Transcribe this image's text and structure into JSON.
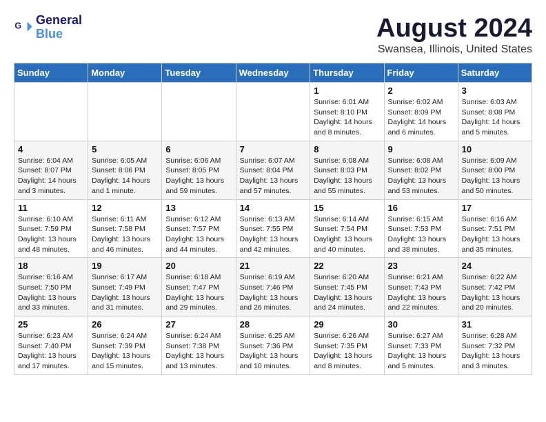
{
  "header": {
    "logo_line1": "General",
    "logo_line2": "Blue",
    "title": "August 2024",
    "subtitle": "Swansea, Illinois, United States"
  },
  "weekdays": [
    "Sunday",
    "Monday",
    "Tuesday",
    "Wednesday",
    "Thursday",
    "Friday",
    "Saturday"
  ],
  "weeks": [
    [
      {
        "day": "",
        "info": ""
      },
      {
        "day": "",
        "info": ""
      },
      {
        "day": "",
        "info": ""
      },
      {
        "day": "",
        "info": ""
      },
      {
        "day": "1",
        "info": "Sunrise: 6:01 AM\nSunset: 8:10 PM\nDaylight: 14 hours\nand 8 minutes."
      },
      {
        "day": "2",
        "info": "Sunrise: 6:02 AM\nSunset: 8:09 PM\nDaylight: 14 hours\nand 6 minutes."
      },
      {
        "day": "3",
        "info": "Sunrise: 6:03 AM\nSunset: 8:08 PM\nDaylight: 14 hours\nand 5 minutes."
      }
    ],
    [
      {
        "day": "4",
        "info": "Sunrise: 6:04 AM\nSunset: 8:07 PM\nDaylight: 14 hours\nand 3 minutes."
      },
      {
        "day": "5",
        "info": "Sunrise: 6:05 AM\nSunset: 8:06 PM\nDaylight: 14 hours\nand 1 minute."
      },
      {
        "day": "6",
        "info": "Sunrise: 6:06 AM\nSunset: 8:05 PM\nDaylight: 13 hours\nand 59 minutes."
      },
      {
        "day": "7",
        "info": "Sunrise: 6:07 AM\nSunset: 8:04 PM\nDaylight: 13 hours\nand 57 minutes."
      },
      {
        "day": "8",
        "info": "Sunrise: 6:08 AM\nSunset: 8:03 PM\nDaylight: 13 hours\nand 55 minutes."
      },
      {
        "day": "9",
        "info": "Sunrise: 6:08 AM\nSunset: 8:02 PM\nDaylight: 13 hours\nand 53 minutes."
      },
      {
        "day": "10",
        "info": "Sunrise: 6:09 AM\nSunset: 8:00 PM\nDaylight: 13 hours\nand 50 minutes."
      }
    ],
    [
      {
        "day": "11",
        "info": "Sunrise: 6:10 AM\nSunset: 7:59 PM\nDaylight: 13 hours\nand 48 minutes."
      },
      {
        "day": "12",
        "info": "Sunrise: 6:11 AM\nSunset: 7:58 PM\nDaylight: 13 hours\nand 46 minutes."
      },
      {
        "day": "13",
        "info": "Sunrise: 6:12 AM\nSunset: 7:57 PM\nDaylight: 13 hours\nand 44 minutes."
      },
      {
        "day": "14",
        "info": "Sunrise: 6:13 AM\nSunset: 7:55 PM\nDaylight: 13 hours\nand 42 minutes."
      },
      {
        "day": "15",
        "info": "Sunrise: 6:14 AM\nSunset: 7:54 PM\nDaylight: 13 hours\nand 40 minutes."
      },
      {
        "day": "16",
        "info": "Sunrise: 6:15 AM\nSunset: 7:53 PM\nDaylight: 13 hours\nand 38 minutes."
      },
      {
        "day": "17",
        "info": "Sunrise: 6:16 AM\nSunset: 7:51 PM\nDaylight: 13 hours\nand 35 minutes."
      }
    ],
    [
      {
        "day": "18",
        "info": "Sunrise: 6:16 AM\nSunset: 7:50 PM\nDaylight: 13 hours\nand 33 minutes."
      },
      {
        "day": "19",
        "info": "Sunrise: 6:17 AM\nSunset: 7:49 PM\nDaylight: 13 hours\nand 31 minutes."
      },
      {
        "day": "20",
        "info": "Sunrise: 6:18 AM\nSunset: 7:47 PM\nDaylight: 13 hours\nand 29 minutes."
      },
      {
        "day": "21",
        "info": "Sunrise: 6:19 AM\nSunset: 7:46 PM\nDaylight: 13 hours\nand 26 minutes."
      },
      {
        "day": "22",
        "info": "Sunrise: 6:20 AM\nSunset: 7:45 PM\nDaylight: 13 hours\nand 24 minutes."
      },
      {
        "day": "23",
        "info": "Sunrise: 6:21 AM\nSunset: 7:43 PM\nDaylight: 13 hours\nand 22 minutes."
      },
      {
        "day": "24",
        "info": "Sunrise: 6:22 AM\nSunset: 7:42 PM\nDaylight: 13 hours\nand 20 minutes."
      }
    ],
    [
      {
        "day": "25",
        "info": "Sunrise: 6:23 AM\nSunset: 7:40 PM\nDaylight: 13 hours\nand 17 minutes."
      },
      {
        "day": "26",
        "info": "Sunrise: 6:24 AM\nSunset: 7:39 PM\nDaylight: 13 hours\nand 15 minutes."
      },
      {
        "day": "27",
        "info": "Sunrise: 6:24 AM\nSunset: 7:38 PM\nDaylight: 13 hours\nand 13 minutes."
      },
      {
        "day": "28",
        "info": "Sunrise: 6:25 AM\nSunset: 7:36 PM\nDaylight: 13 hours\nand 10 minutes."
      },
      {
        "day": "29",
        "info": "Sunrise: 6:26 AM\nSunset: 7:35 PM\nDaylight: 13 hours\nand 8 minutes."
      },
      {
        "day": "30",
        "info": "Sunrise: 6:27 AM\nSunset: 7:33 PM\nDaylight: 13 hours\nand 5 minutes."
      },
      {
        "day": "31",
        "info": "Sunrise: 6:28 AM\nSunset: 7:32 PM\nDaylight: 13 hours\nand 3 minutes."
      }
    ]
  ]
}
